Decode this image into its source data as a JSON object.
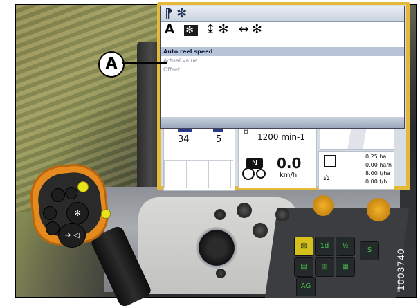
{
  "callout": {
    "label": "A"
  },
  "popup": {
    "header_icons": "⁋ ✻",
    "mode_a": "A",
    "mode_reel": "✻",
    "mode_height": "↨✻",
    "mode_fore_aft": "↔✻",
    "menu": [
      {
        "label": "Auto reel speed",
        "selected": true
      },
      {
        "label": "Actual value",
        "selected": false
      },
      {
        "label": "Offset",
        "selected": false
      }
    ]
  },
  "dash": {
    "counter_left": "34",
    "counter_right": "5",
    "engine_speed": "1200 min-1",
    "gear": "N",
    "speed_value": "0.0",
    "speed_unit": "km/h",
    "area_ha": "0.25 ha",
    "area_rate": "0.00 ha/h",
    "yield_tha": "8.00 t/ha",
    "yield_th": "0.00 t/h"
  },
  "keypad": {
    "key_ag": "AG"
  },
  "figure_id": "1003740",
  "colors": {
    "screen_bezel": "#e4b93a",
    "selected_row": "#b7c4d8",
    "grip_orange": "#e48a1e",
    "yellow_button": "#e8e31a"
  }
}
